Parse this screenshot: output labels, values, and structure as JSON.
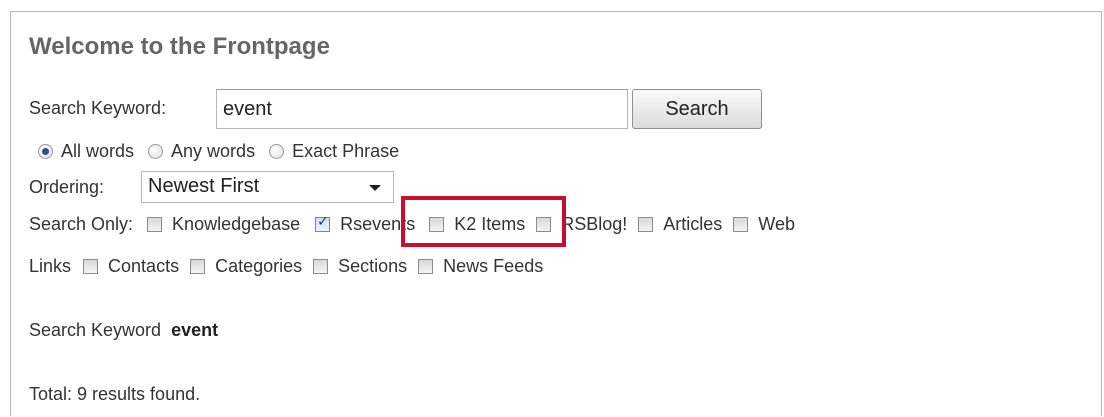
{
  "page": {
    "title": "Welcome to the Frontpage"
  },
  "search": {
    "keyword_label": "Search Keyword:",
    "keyword_value": "event",
    "button_label": "Search"
  },
  "match_mode": {
    "options": [
      {
        "label": "All words",
        "checked": true
      },
      {
        "label": "Any words",
        "checked": false
      },
      {
        "label": "Exact Phrase",
        "checked": false
      }
    ]
  },
  "ordering": {
    "label": "Ordering:",
    "selected": "Newest First"
  },
  "search_only": {
    "label": "Search Only:",
    "areas": [
      {
        "label": "Knowledgebase",
        "checked": false
      },
      {
        "label": "Rsevents",
        "checked": true
      },
      {
        "label": "K2 Items",
        "checked": false
      },
      {
        "label": "RSBlog!",
        "checked": false
      },
      {
        "label": "Articles",
        "checked": false
      },
      {
        "label": "Web Links",
        "checked": false
      },
      {
        "label": "Contacts",
        "checked": false
      },
      {
        "label": "Categories",
        "checked": false
      },
      {
        "label": "Sections",
        "checked": false
      },
      {
        "label": "News Feeds",
        "checked": false
      }
    ],
    "web_links_part1": "Web",
    "web_links_part2": "Links"
  },
  "results": {
    "keyword_prefix": "Search Keyword",
    "keyword": "event",
    "total": "Total: 9 results found."
  },
  "colors": {
    "highlight": "#c8102e",
    "title": "#666666"
  }
}
